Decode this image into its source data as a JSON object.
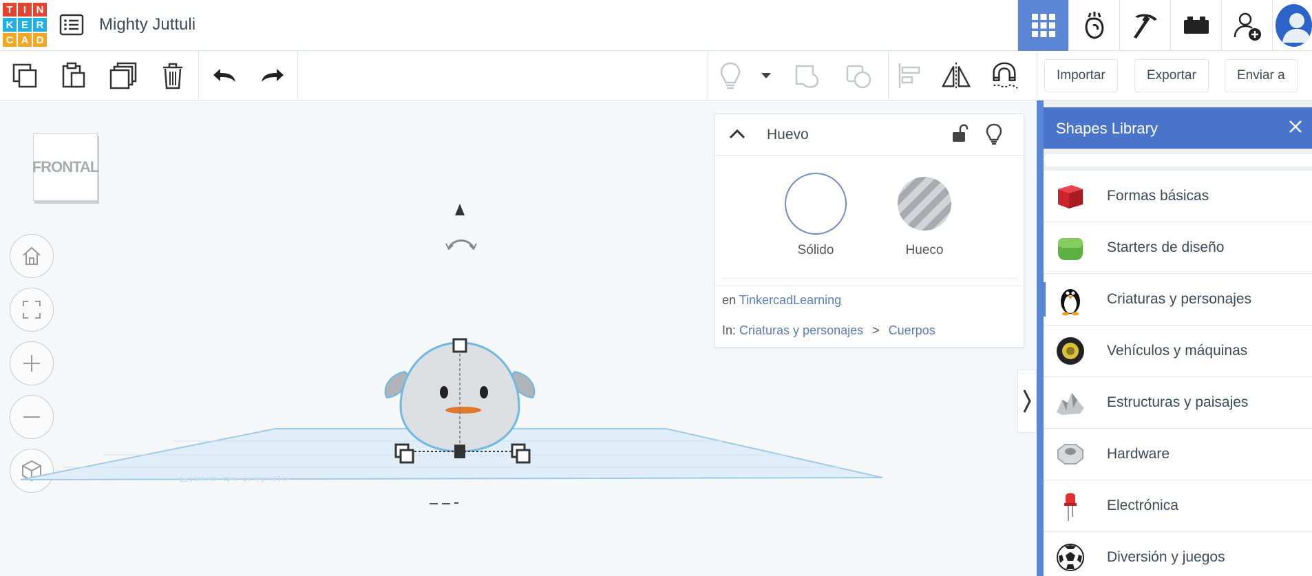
{
  "app": {
    "logo_letters": [
      "T",
      "I",
      "N",
      "K",
      "E",
      "R",
      "C",
      "A",
      "D"
    ],
    "logo_colors": [
      "#e2442f",
      "#e2442f",
      "#e2442f",
      "#1fb0e8",
      "#1fb0e8",
      "#1fb0e8",
      "#f5a623",
      "#f5a623",
      "#f5a623"
    ],
    "document_title": "Mighty Juttuli",
    "accent": "#5b86d6"
  },
  "top_nav": {
    "icons": [
      "grid-view-icon",
      "sim-lab-icon",
      "pickaxe-icon",
      "bricks-icon",
      "add-user-icon",
      "user-avatar"
    ]
  },
  "toolbar": {
    "import_label": "Importar",
    "export_label": "Exportar",
    "send_label": "Enviar a"
  },
  "viewcube": {
    "face_label": "FRONTAL"
  },
  "properties": {
    "title": "Huevo",
    "solid_label": "Sólido",
    "hole_label": "Hueco",
    "author_prefix": "en",
    "author": "TinkercadLearning",
    "path_prefix": "In:",
    "path_category": "Criaturas y personajes",
    "path_separator": ">",
    "path_subcategory": "Cuerpos"
  },
  "library": {
    "header": "Shapes Library",
    "items": [
      {
        "label": "Formas básicas",
        "icon": "red-cube-icon"
      },
      {
        "label": "Starters de diseño",
        "icon": "green-cube-icon"
      },
      {
        "label": "Criaturas y personajes",
        "icon": "penguin-icon"
      },
      {
        "label": "Vehículos y máquinas",
        "icon": "wheel-icon"
      },
      {
        "label": "Estructuras y paisajes",
        "icon": "rock-icon"
      },
      {
        "label": "Hardware",
        "icon": "nut-icon"
      },
      {
        "label": "Electrónica",
        "icon": "led-icon"
      },
      {
        "label": "Diversión y juegos",
        "icon": "soccer-ball-icon"
      }
    ]
  },
  "workplane": {
    "label": "Plano de trabajo"
  }
}
